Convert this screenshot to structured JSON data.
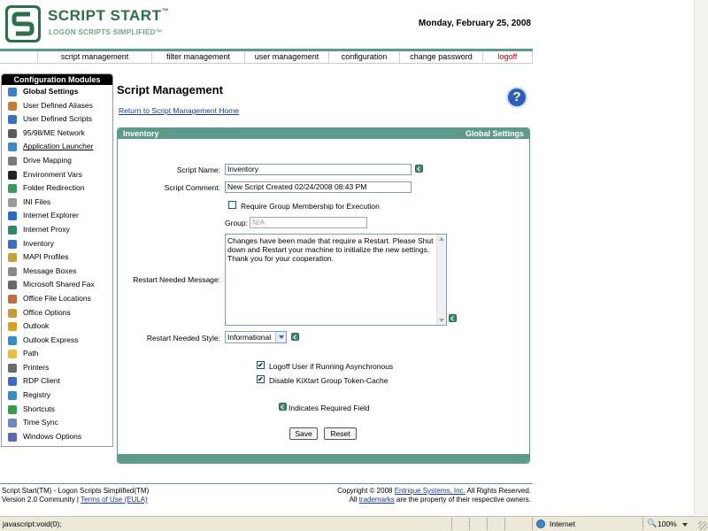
{
  "header": {
    "logo_title": "SCRIPT START",
    "logo_tm": "™",
    "logo_tagline": "LOGON SCRIPTS SIMPLIFIED™",
    "date": "Monday, February 25, 2008"
  },
  "nav": [
    {
      "label": "script management"
    },
    {
      "label": "filter management"
    },
    {
      "label": "user management"
    },
    {
      "label": "configuration"
    },
    {
      "label": "change password"
    },
    {
      "label": "logoff"
    }
  ],
  "sidebar": {
    "title": "Configuration Modules",
    "items": [
      {
        "label": "Global Settings",
        "icon": "globe-icon",
        "color": "#3a7fc8"
      },
      {
        "label": "User Defined Aliases",
        "icon": "users-icon",
        "color": "#c87a3a"
      },
      {
        "label": "User Defined Scripts",
        "icon": "script-icon",
        "color": "#3a6fc8"
      },
      {
        "label": "95/98/ME Network",
        "icon": "network-icon",
        "color": "#5a5a5a"
      },
      {
        "label": "Application Launcher",
        "icon": "launcher-icon",
        "color": "#3a8ac8"
      },
      {
        "label": "Drive Mapping",
        "icon": "drive-icon",
        "color": "#7a7a7a"
      },
      {
        "label": "Environment Vars",
        "icon": "terminal-icon",
        "color": "#222222"
      },
      {
        "label": "Folder Redirection",
        "icon": "folder-redirect-icon",
        "color": "#3a9a5a"
      },
      {
        "label": "INI Files",
        "icon": "ini-file-icon",
        "color": "#9a9a9a"
      },
      {
        "label": "Internet Explorer",
        "icon": "ie-icon",
        "color": "#2a6ac8"
      },
      {
        "label": "Internet Proxy",
        "icon": "proxy-icon",
        "color": "#2a8a6a"
      },
      {
        "label": "Inventory",
        "icon": "inventory-icon",
        "color": "#3a6fc8"
      },
      {
        "label": "MAPI Profiles",
        "icon": "mapi-icon",
        "color": "#c8a03a"
      },
      {
        "label": "Message Boxes",
        "icon": "message-icon",
        "color": "#8a8a8a"
      },
      {
        "label": "Microsoft Shared Fax",
        "icon": "fax-icon",
        "color": "#6a6a6a"
      },
      {
        "label": "Office File Locations",
        "icon": "office-files-icon",
        "color": "#c86a3a"
      },
      {
        "label": "Office Options",
        "icon": "office-options-icon",
        "color": "#c89a3a"
      },
      {
        "label": "Outlook",
        "icon": "outlook-icon",
        "color": "#d8a020"
      },
      {
        "label": "Outlook Express",
        "icon": "outlook-express-icon",
        "color": "#3a8ac8"
      },
      {
        "label": "Path",
        "icon": "folder-icon",
        "color": "#e8c040"
      },
      {
        "label": "Printers",
        "icon": "printer-icon",
        "color": "#6a6a6a"
      },
      {
        "label": "RDP Client",
        "icon": "rdp-icon",
        "color": "#3a6ac8"
      },
      {
        "label": "Registry",
        "icon": "registry-icon",
        "color": "#3a8ac8"
      },
      {
        "label": "Shortcuts",
        "icon": "shortcut-icon",
        "color": "#3a9a4a"
      },
      {
        "label": "Time Sync",
        "icon": "clock-icon",
        "color": "#6a8ac8"
      },
      {
        "label": "Windows Options",
        "icon": "windows-icon",
        "color": "#5a6ab8"
      }
    ]
  },
  "main": {
    "title": "Script Management",
    "help_glyph": "?",
    "return_link": "Return to Script Management Home",
    "panel": {
      "left_title": "Inventory",
      "right_title": "Global Settings"
    },
    "form": {
      "script_name_label": "Script Name:",
      "script_name_value": "Inventory",
      "script_comment_label": "Script Comment:",
      "script_comment_value": "New Script Created 02/24/2008 08:43 PM",
      "require_group_label": "Require Group Membership for Execution",
      "require_group_checked": false,
      "group_label": "Group:",
      "group_value": "N/A",
      "restart_msg_label": "Restart Needed Message:",
      "restart_msg_value": "Changes have been made that require a Restart. Please Shut down and Restart your machine to initialize the new settings. Thank you for your cooperation.",
      "restart_style_label": "Restart Needed Style:",
      "restart_style_value": "Informational",
      "logoff_async_label": "Logoff User if Running Asynchronous",
      "logoff_async_checked": true,
      "disable_kix_label": "Disable KiXtart Group Token-Cache",
      "disable_kix_checked": true,
      "required_legend": "Indicates Required Field",
      "save_label": "Save",
      "reset_label": "Reset",
      "check_glyph": "✔"
    }
  },
  "footer": {
    "product": "Script Start(TM) - Logon Scripts Simplified(TM)",
    "version": "Version 2.0 Community",
    "separator": " | ",
    "terms_link": "Terms of Use (EULA)",
    "copyright_prefix": "Copyright © 2008 ",
    "company_link": "Entrique Systems, Inc.",
    "copyright_suffix": " All Rights Reserved.",
    "trademarks_prefix": "All ",
    "trademarks_link": "trademarks",
    "trademarks_suffix": " are the property of their respective owners."
  },
  "statusbar": {
    "text": "javascript:void(0);",
    "zone": "Internet",
    "zoom": "100%",
    "zoom_glyph": "🔍"
  },
  "colors": {
    "brand_green": "#2c6f4a",
    "panel_teal": "#5d9a8a",
    "link_blue": "#1a3a9a",
    "logoff_red": "#cc0000"
  }
}
